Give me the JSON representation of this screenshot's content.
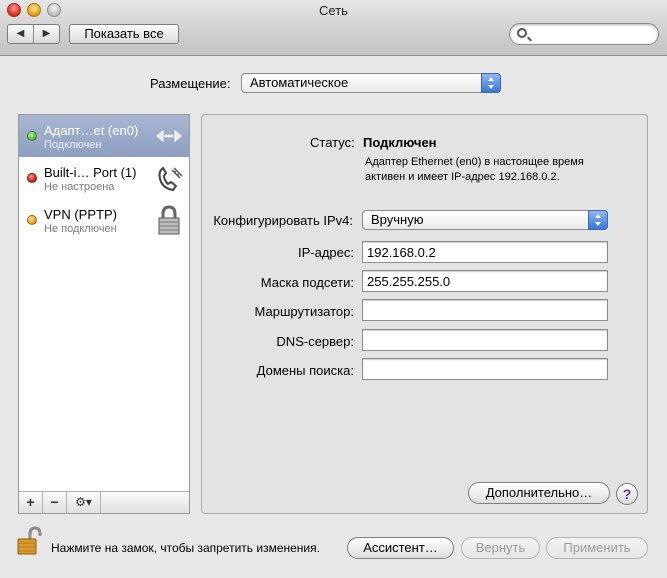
{
  "window": {
    "title": "Сеть"
  },
  "toolbar": {
    "back_glyph": "◀",
    "forward_glyph": "▶",
    "show_all_label": "Показать все",
    "search_value": ""
  },
  "location": {
    "label": "Размещение:",
    "value": "Автоматическое"
  },
  "services": [
    {
      "name": "Адапт…et (en0)",
      "status": "Подключен",
      "status_color": "#5fc13a",
      "icon": "ethernet-icon",
      "selected": true
    },
    {
      "name": "Built-i… Port (1)",
      "status": "Не настроена",
      "status_color": "#d8221b",
      "icon": "phone-modem-icon",
      "selected": false
    },
    {
      "name": "VPN (PPTP)",
      "status": "Не подключен",
      "status_color": "#f0a41c",
      "icon": "vpn-lock-icon",
      "selected": false
    }
  ],
  "sidebar_buttons": {
    "add": "+",
    "remove": "−",
    "gear": "⚙▾"
  },
  "detail": {
    "status_label": "Статус:",
    "status_value": "Подключен",
    "status_description": "Адаптер Ethernet (en0) в настоящее время активен и имеет IP-адрес 192.168.0.2.",
    "configure_label": "Конфигурировать IPv4:",
    "configure_value": "Вручную",
    "ip_label": "IP-адрес:",
    "ip_value": "192.168.0.2",
    "mask_label": "Маска подсети:",
    "mask_value": "255.255.255.0",
    "router_label": "Маршрутизатор:",
    "router_value": "",
    "dns_label": "DNS-сервер:",
    "dns_value": "",
    "search_domains_label": "Домены поиска:",
    "search_domains_value": "",
    "advanced_label": "Дополнительно…",
    "help_glyph": "?"
  },
  "footer": {
    "lock_text": "Нажмите на замок, чтобы запретить изменения.",
    "assistant_label": "Ассистент…",
    "revert_label": "Вернуть",
    "apply_label": "Применить"
  },
  "colors": {
    "selection": "#8e9fc1",
    "popup_arrow": "#3a75d6"
  }
}
